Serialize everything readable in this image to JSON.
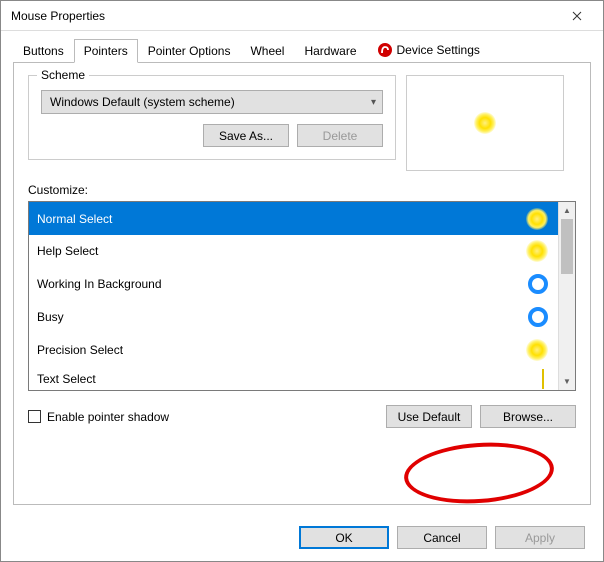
{
  "window": {
    "title": "Mouse Properties"
  },
  "tabs": [
    {
      "label": "Buttons"
    },
    {
      "label": "Pointers"
    },
    {
      "label": "Pointer Options"
    },
    {
      "label": "Wheel"
    },
    {
      "label": "Hardware"
    },
    {
      "label": "Device Settings"
    }
  ],
  "active_tab": 1,
  "scheme": {
    "legend": "Scheme",
    "selected": "Windows Default (system scheme)",
    "save_as": "Save As...",
    "delete": "Delete"
  },
  "customize": {
    "label": "Customize:",
    "items": [
      {
        "label": "Normal Select",
        "icon": "yellow-glow",
        "selected": true
      },
      {
        "label": "Help Select",
        "icon": "yellow-glow"
      },
      {
        "label": "Working In Background",
        "icon": "blue-ring"
      },
      {
        "label": "Busy",
        "icon": "blue-ring"
      },
      {
        "label": "Precision Select",
        "icon": "yellow-glow"
      },
      {
        "label": "Text Select",
        "icon": "ibeam"
      }
    ]
  },
  "controls": {
    "enable_shadow": "Enable pointer shadow",
    "use_default": "Use Default",
    "browse": "Browse..."
  },
  "buttons": {
    "ok": "OK",
    "cancel": "Cancel",
    "apply": "Apply"
  },
  "annotation": {
    "target": "browse-button"
  }
}
